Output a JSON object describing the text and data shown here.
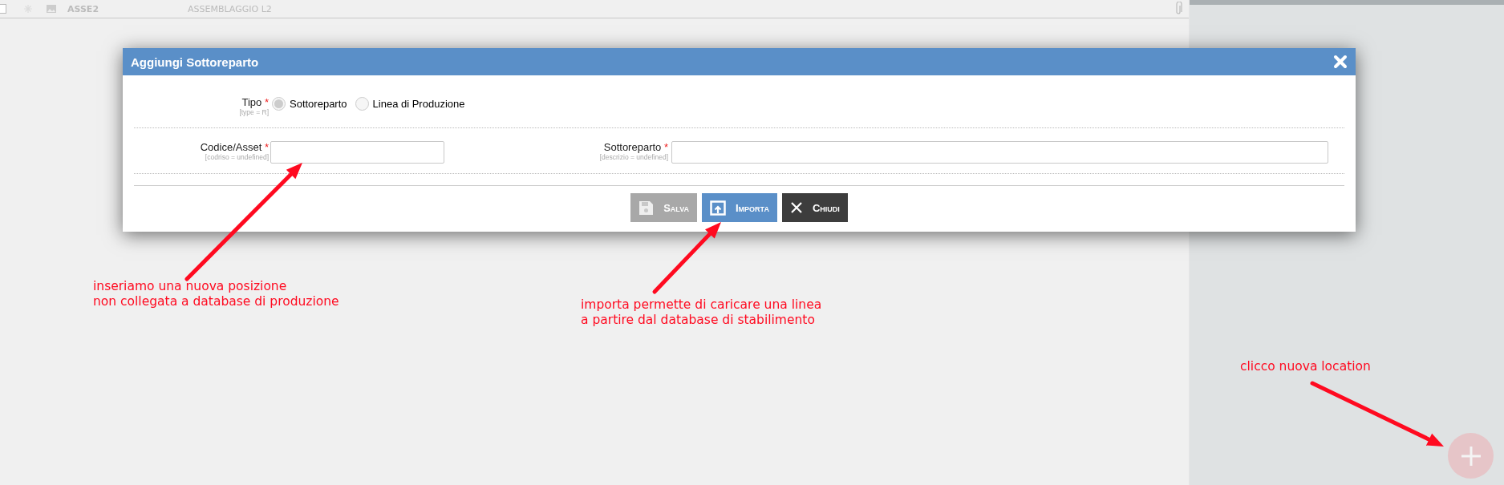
{
  "background_row": {
    "checked": false,
    "code": "ASSE2",
    "description": "ASSEMBLAGGIO L2"
  },
  "dialog": {
    "title": "Aggiungi Sottoreparto",
    "type_field": {
      "label": "Tipo",
      "required_mark": "*",
      "hint": "[type = R]",
      "options": [
        {
          "label": "Sottoreparto",
          "selected": true
        },
        {
          "label": "Linea di Produzione",
          "selected": false
        }
      ]
    },
    "fields": [
      {
        "label": "Codice/Asset",
        "required_mark": "*",
        "hint": "[codriso = undefined]"
      },
      {
        "label": "Sottoreparto",
        "required_mark": "*",
        "hint": "[descrizio = undefined]"
      }
    ],
    "buttons": [
      {
        "kind": "save",
        "label": "Salva",
        "disabled": true
      },
      {
        "kind": "import",
        "label": "Importa",
        "disabled": false
      },
      {
        "kind": "close",
        "label": "Chiudi",
        "disabled": false
      }
    ]
  },
  "annotations": [
    {
      "lines": [
        "inseriamo una nuova posizione",
        "non collegata a database di produzione"
      ]
    },
    {
      "lines": [
        "importa permette di caricare una linea",
        "a partire dal database di stabilimento"
      ]
    },
    {
      "lines": [
        "clicco nuova location"
      ]
    }
  ]
}
